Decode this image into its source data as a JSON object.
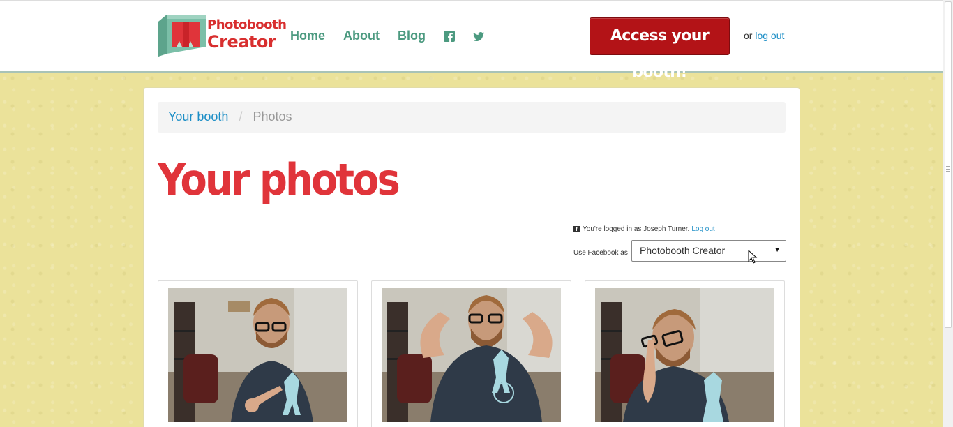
{
  "brand": {
    "line1": "Photobooth",
    "line2": "Creator"
  },
  "nav": {
    "home": "Home",
    "about": "About",
    "blog": "Blog",
    "facebook_icon": "facebook-icon",
    "twitter_icon": "twitter-icon"
  },
  "header": {
    "access_button": "Access your booth!",
    "or_text": "or",
    "logout_link": "log out"
  },
  "breadcrumb": {
    "root": "Your booth",
    "separator": "/",
    "current": "Photos"
  },
  "page_title": "Your photos",
  "facebook": {
    "status_prefix": "You're logged in as Joseph Turner.",
    "status_logout": "Log out",
    "use_label": "Use Facebook as",
    "selected_account": "Photobooth Creator"
  },
  "photos": [
    {
      "alt": "photo 1",
      "pose": "pointing"
    },
    {
      "alt": "photo 2",
      "pose": "flexing"
    },
    {
      "alt": "photo 3",
      "pose": "finger-on-nose"
    }
  ],
  "colors": {
    "brand_red": "#d82f2f",
    "nav_green": "#4c9a80",
    "button_red": "#b31317",
    "link_blue": "#1c8ec6",
    "background_yellow": "#ebe29a"
  }
}
